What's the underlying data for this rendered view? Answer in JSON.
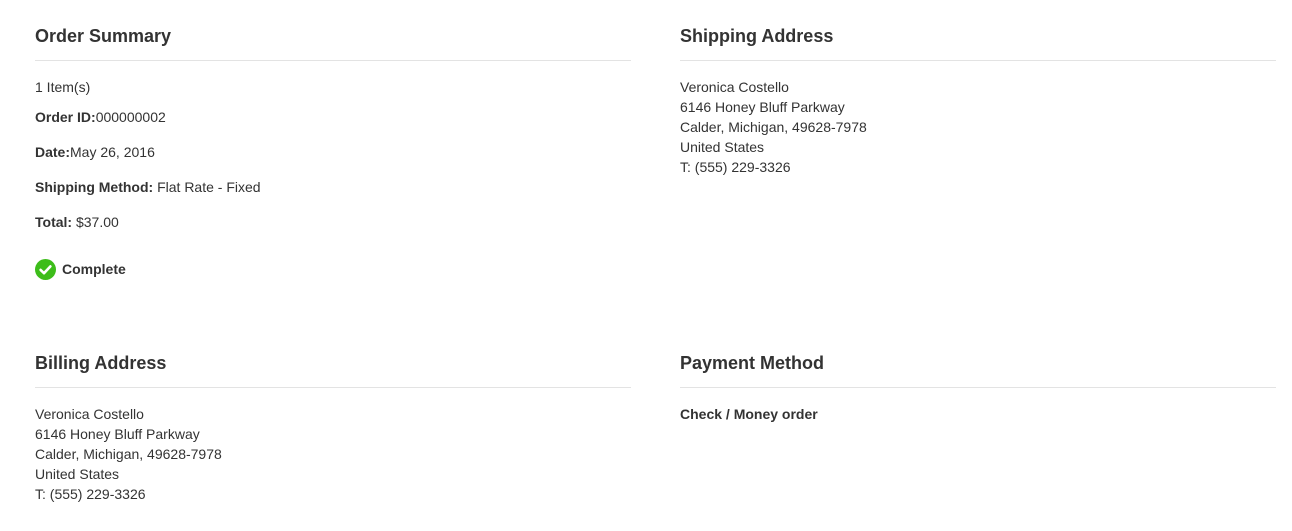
{
  "order_summary": {
    "title": "Order Summary",
    "items_count": "1 Item(s)",
    "order_id_label": "Order ID:",
    "order_id_value": "000000002",
    "date_label": "Date:",
    "date_value": "May 26, 2016",
    "shipping_method_label": "Shipping Method:",
    "shipping_method_value": " Flat Rate - Fixed",
    "total_label": "Total:",
    "total_value": " $37.00",
    "status": {
      "label": "Complete",
      "icon": "check-circle-icon",
      "color": "#3dbd1a"
    }
  },
  "shipping_address": {
    "title": "Shipping Address",
    "name": "Veronica Costello",
    "street": "6146 Honey Bluff Parkway",
    "city_line": "Calder, Michigan, 49628-7978",
    "country": "United States",
    "phone": "T: (555) 229-3326"
  },
  "billing_address": {
    "title": "Billing Address",
    "name": "Veronica Costello",
    "street": "6146 Honey Bluff Parkway",
    "city_line": "Calder, Michigan, 49628-7978",
    "country": "United States",
    "phone": "T: (555) 229-3326"
  },
  "payment_method": {
    "title": "Payment Method",
    "name": "Check / Money order"
  }
}
